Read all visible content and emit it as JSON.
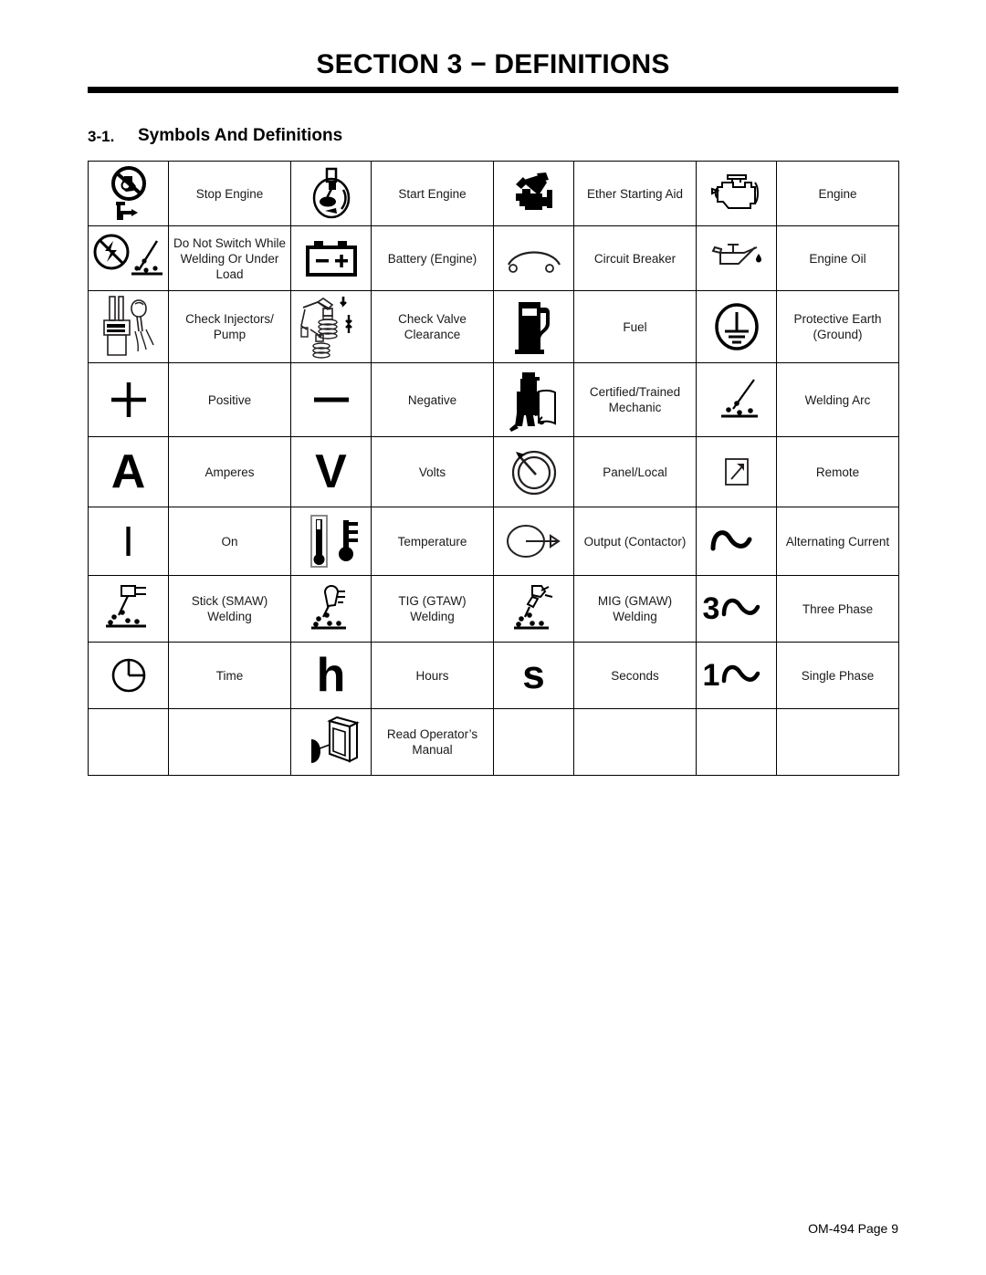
{
  "header": {
    "section_title": "SECTION 3 − DEFINITIONS",
    "subsection_number": "3-1.",
    "subsection_title": "Symbols And Definitions"
  },
  "footer": {
    "page_ref": "OM-494 Page 9"
  },
  "table": {
    "rows": [
      {
        "cells": [
          {
            "icon": "stop-engine-icon",
            "label": "Stop Engine"
          },
          {
            "icon": "start-engine-icon",
            "label": "Start Engine"
          },
          {
            "icon": "ether-starting-aid-icon",
            "label": "Ether Starting Aid"
          },
          {
            "icon": "engine-icon",
            "label": "Engine"
          }
        ]
      },
      {
        "cells": [
          {
            "icon": "do-not-switch-icon",
            "label": "Do Not Switch While Welding Or Under Load"
          },
          {
            "icon": "battery-icon",
            "label": "Battery (Engine)"
          },
          {
            "icon": "circuit-breaker-icon",
            "label": "Circuit Breaker"
          },
          {
            "icon": "engine-oil-icon",
            "label": "Engine Oil"
          }
        ]
      },
      {
        "cells": [
          {
            "icon": "check-injectors-pump-icon",
            "label": "Check Injectors/ Pump"
          },
          {
            "icon": "check-valve-clearance-icon",
            "label": "Check Valve Clearance"
          },
          {
            "icon": "fuel-pump-icon",
            "label": "Fuel"
          },
          {
            "icon": "protective-earth-ground-icon",
            "label": "Protective Earth (Ground)"
          }
        ]
      },
      {
        "cells": [
          {
            "icon": "plus-sign-icon",
            "label": "Positive"
          },
          {
            "icon": "minus-sign-icon",
            "label": "Negative"
          },
          {
            "icon": "certified-mechanic-icon",
            "label": "Certified/Trained Mechanic"
          },
          {
            "icon": "welding-arc-icon",
            "label": "Welding Arc"
          }
        ]
      },
      {
        "cells": [
          {
            "icon": "letter-a-icon",
            "label": "Amperes"
          },
          {
            "icon": "letter-v-icon",
            "label": "Volts"
          },
          {
            "icon": "panel-local-dial-icon",
            "label": "Panel/Local"
          },
          {
            "icon": "remote-arrow-icon",
            "label": "Remote"
          }
        ]
      },
      {
        "cells": [
          {
            "icon": "on-bar-icon",
            "label": "On"
          },
          {
            "icon": "thermometer-icon",
            "label": "Temperature"
          },
          {
            "icon": "output-contactor-icon",
            "label": "Output (Contactor)"
          },
          {
            "icon": "alternating-current-icon",
            "label": "Alternating Current"
          }
        ]
      },
      {
        "cells": [
          {
            "icon": "stick-welding-icon",
            "label": "Stick (SMAW) Welding"
          },
          {
            "icon": "tig-welding-icon",
            "label": "TIG (GTAW) Welding"
          },
          {
            "icon": "mig-welding-icon",
            "label": "MIG (GMAW) Welding"
          },
          {
            "icon": "three-phase-icon",
            "label": "Three Phase"
          }
        ]
      },
      {
        "cells": [
          {
            "icon": "clock-time-icon",
            "label": "Time"
          },
          {
            "icon": "letter-h-icon",
            "label": "Hours"
          },
          {
            "icon": "letter-s-icon",
            "label": "Seconds"
          },
          {
            "icon": "single-phase-icon",
            "label": "Single Phase"
          }
        ]
      },
      {
        "cells": [
          {
            "icon": "",
            "label": ""
          },
          {
            "icon": "read-operators-manual-icon",
            "label": "Read Operator’s Manual"
          },
          {
            "icon": "",
            "label": ""
          },
          {
            "icon": "",
            "label": ""
          }
        ]
      }
    ],
    "glyphs": {
      "letter_a": "A",
      "letter_v": "V",
      "on_bar": "I",
      "letter_h": "h",
      "letter_s": "s",
      "plus": "+",
      "three": "3",
      "one": "1"
    }
  },
  "colors": {
    "ink": "#000000",
    "text": "#1a1a1a",
    "page_background": "#ffffff"
  }
}
